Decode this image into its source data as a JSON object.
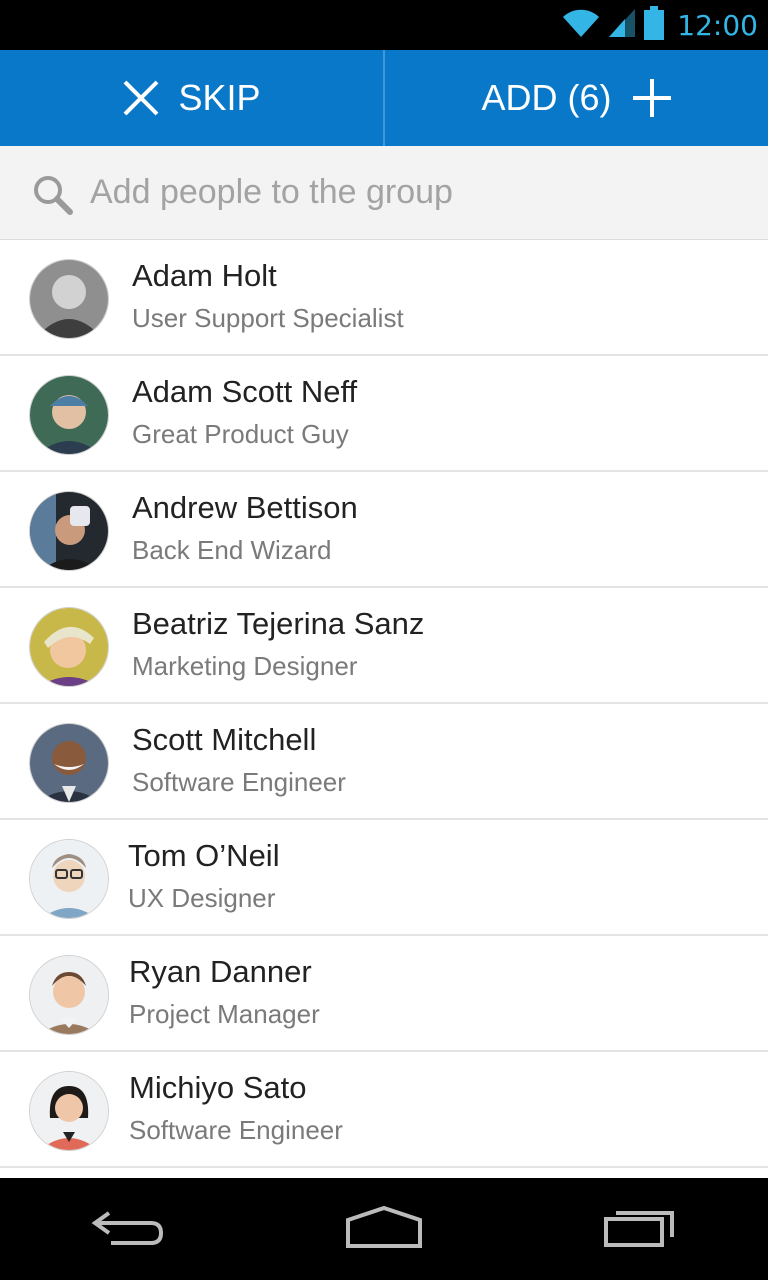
{
  "status_bar": {
    "time": "12:00",
    "accent_color": "#33b5e5",
    "icons": [
      "wifi-icon",
      "signal-icon",
      "battery-icon"
    ]
  },
  "action_bar": {
    "skip_label": "SKIP",
    "add_label": "ADD (6)",
    "background_color": "#0a78c8"
  },
  "search": {
    "placeholder": "Add people to the group",
    "value": ""
  },
  "contacts": [
    {
      "name": "Adam Holt",
      "role": "User Support Specialist"
    },
    {
      "name": "Adam Scott Neff",
      "role": "Great Product Guy"
    },
    {
      "name": "Andrew Bettison",
      "role": "Back End Wizard"
    },
    {
      "name": "Beatriz Tejerina Sanz",
      "role": "Marketing Designer"
    },
    {
      "name": "Scott Mitchell",
      "role": "Software Engineer"
    },
    {
      "name": "Tom O’Neil",
      "role": "UX Designer"
    },
    {
      "name": "Ryan Danner",
      "role": "Project Manager"
    },
    {
      "name": "Michiyo Sato",
      "role": "Software Engineer"
    }
  ],
  "nav_bar": {
    "icons": [
      "back-icon",
      "home-icon",
      "recent-apps-icon"
    ]
  }
}
